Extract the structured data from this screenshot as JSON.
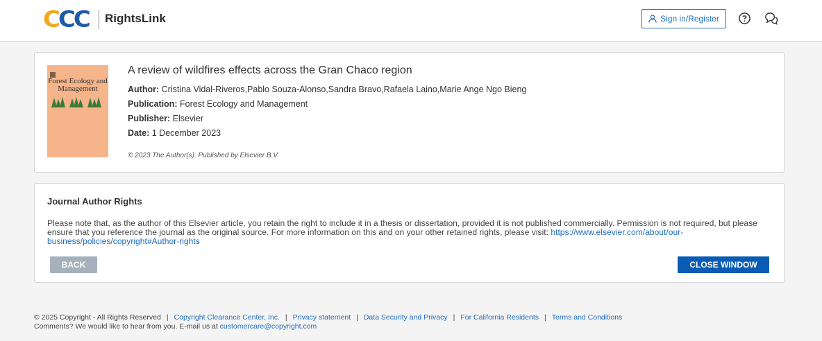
{
  "header": {
    "logo_text": "CCC",
    "brand": "RightsLink",
    "signin_label": "Sign in/Register",
    "colors": {
      "logo_blue": "#1e5aa8",
      "logo_orange": "#f2a71c",
      "accent": "#1f6dbf"
    }
  },
  "article": {
    "cover_title": "Forest Ecology and Management",
    "title": "A review of wildfires effects across the Gran Chaco region",
    "author_label": "Author:",
    "author": "Cristina Vidal-Riveros,Pablo Souza-Alonso,Sandra Bravo,Rafaela Laino,Marie Ange Ngo Bieng",
    "publication_label": "Publication:",
    "publication": "Forest Ecology and Management",
    "publisher_label": "Publisher:",
    "publisher": "Elsevier",
    "date_label": "Date:",
    "date": "1 December 2023",
    "copyright": "© 2023 The Author(s). Published by Elsevier B.V."
  },
  "rights": {
    "title": "Journal Author Rights",
    "body": "Please note that, as the author of this Elsevier article, you retain the right to include it in a thesis or dissertation, provided it is not published commercially. Permission is not required, but please ensure that you reference the journal as the original source. For more information on this and on your other retained rights, please visit: ",
    "link": "https://www.elsevier.com/about/our-business/policies/copyright#Author-rights",
    "back_label": "BACK",
    "close_label": "CLOSE WINDOW"
  },
  "footer": {
    "copyright": "© 2025 Copyright - All Rights Reserved",
    "links": [
      "Copyright Clearance Center, Inc.",
      "Privacy statement",
      "Data Security and Privacy",
      "For California Residents",
      "Terms and Conditions"
    ],
    "comments_prefix": "Comments? We would like to hear from you. E-mail us at ",
    "email": "customercare@copyright.com"
  }
}
